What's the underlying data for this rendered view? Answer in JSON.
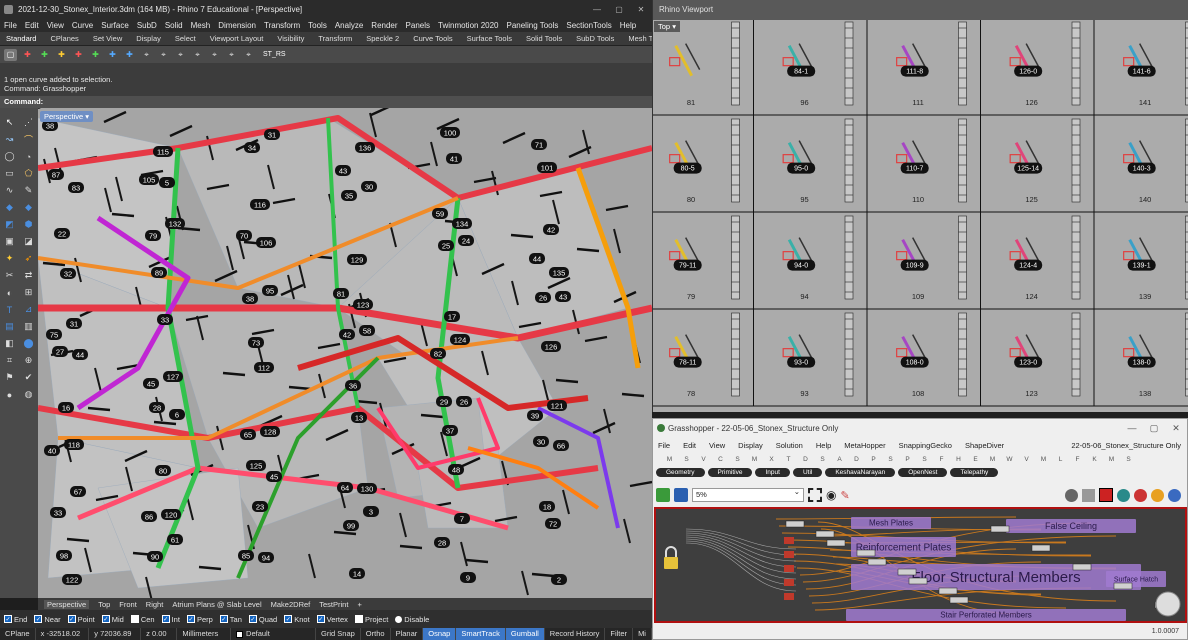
{
  "rhino": {
    "title": "2021-12-30_Stonex_Interior.3dm (164 MB) - Rhino 7 Educational - [Perspective]",
    "menu": [
      "File",
      "Edit",
      "View",
      "Curve",
      "Surface",
      "SubD",
      "Solid",
      "Mesh",
      "Dimension",
      "Transform",
      "Tools",
      "Analyze",
      "Render",
      "Panels",
      "Twinmotion 2020",
      "Paneling Tools",
      "SectionTools",
      "Help"
    ],
    "tabs": [
      "Standard",
      "CPlanes",
      "Set View",
      "Display",
      "Select",
      "Viewport Layout",
      "Visibility",
      "Transform",
      "Speckle 2",
      "Curve Tools",
      "Surface Tools",
      "Solid Tools",
      "SubD Tools",
      "Mesh Tools"
    ],
    "toolbar_label": "ST_RS",
    "command_history": [
      "1 open curve added to selection.",
      "Command: Grasshopper"
    ],
    "command_prompt": "Command:",
    "viewport_name": "Perspective",
    "viewport_tabs": [
      "Perspective",
      "Top",
      "Front",
      "Right",
      "Atrium Plans @ Slab Level",
      "Make2DRef",
      "TestPrint",
      "+"
    ],
    "osnap": [
      {
        "label": "End",
        "checked": true
      },
      {
        "label": "Near",
        "checked": true
      },
      {
        "label": "Point",
        "checked": true
      },
      {
        "label": "Mid",
        "checked": true
      },
      {
        "label": "Cen",
        "checked": false
      },
      {
        "label": "Int",
        "checked": true
      },
      {
        "label": "Perp",
        "checked": true
      },
      {
        "label": "Tan",
        "checked": true
      },
      {
        "label": "Quad",
        "checked": true
      },
      {
        "label": "Knot",
        "checked": true
      },
      {
        "label": "Vertex",
        "checked": true
      }
    ],
    "osnap_project": "Project",
    "osnap_disable": "Disable",
    "status": {
      "cplane": "CPlane",
      "x": "x -32518.02",
      "y": "y 72036.89",
      "z": "z 0.00",
      "units": "Millimeters",
      "layer": "Default",
      "grid_snap": "Grid Snap",
      "ortho": "Ortho",
      "planar": "Planar",
      "osnap": "Osnap",
      "smarttrack": "SmartTrack",
      "gumball": "Gumball",
      "record_history": "Record History",
      "filter": "Filter",
      "filter_extra": "Mi"
    },
    "member_labels": [
      "38",
      "105",
      "70",
      "81",
      "82",
      "39",
      "40",
      "86",
      "85",
      "43",
      "59",
      "44",
      "75",
      "45",
      "65",
      "64",
      "28",
      "71",
      "87",
      "79",
      "38",
      "42",
      "29",
      "30",
      "33",
      "90",
      "34",
      "35",
      "25",
      "26",
      "27",
      "28",
      "125",
      "99",
      "100",
      "101",
      "22",
      "89",
      "73",
      "36",
      "37",
      "18",
      "98",
      "115",
      "116",
      "129",
      "17",
      "126",
      "16",
      "80",
      "23",
      "14",
      "41",
      "42",
      "32",
      "33",
      "112",
      "13",
      "48",
      "72",
      "122",
      "5",
      "106",
      "123",
      "124",
      "121",
      "118",
      "120",
      "94",
      "136",
      "134",
      "135",
      "31",
      "127",
      "128",
      "130",
      "7",
      "2",
      "83",
      "132",
      "95",
      "58",
      "26",
      "66",
      "67",
      "61",
      "31",
      "30",
      "24",
      "43",
      "44",
      "6",
      "45",
      "3",
      "9"
    ]
  },
  "rhino_viewport": {
    "title": "Rhino Viewport",
    "view_name": "Top",
    "cell_numbers": [
      [
        "81",
        "96",
        "111",
        "126",
        "141"
      ],
      [
        "80",
        "95",
        "110",
        "125",
        "140"
      ],
      [
        "79",
        "94",
        "109",
        "124",
        "139"
      ],
      [
        "78",
        "93",
        "108",
        "123",
        "138"
      ]
    ],
    "cell_tags": [
      [
        "",
        "84-1",
        "111-8",
        "126-0",
        "141-6"
      ],
      [
        "80-5",
        "95-0",
        "110-7",
        "125-14",
        "140-3"
      ],
      [
        "79-11",
        "94-0",
        "109-9",
        "124-4",
        "139-1"
      ],
      [
        "78-11",
        "93-0",
        "108-0",
        "123-0",
        "138-0"
      ]
    ]
  },
  "grasshopper": {
    "title": "Grasshopper - 22-05-06_Stonex_Structure Only",
    "menu": [
      "File",
      "Edit",
      "View",
      "Display",
      "Solution",
      "Help",
      "MetaHopper",
      "SnappingGecko",
      "ShapeDiver"
    ],
    "document": "22-05-06_Stonex_Structure Only",
    "category_letters": [
      "M",
      "S",
      "V",
      "C",
      "S",
      "M",
      "X",
      "T",
      "D",
      "S",
      "A",
      "D",
      "P",
      "S",
      "P",
      "S",
      "F",
      "H",
      "E",
      "M",
      "W",
      "V",
      "M",
      "L",
      "F",
      "K",
      "M",
      "S"
    ],
    "subtabs": [
      "Geometry",
      "Primitive",
      "Input",
      "Util",
      "KeshavaNarayan",
      "OpenNest",
      "Telepathy"
    ],
    "zoom": "5%",
    "groups": [
      "Mesh Plates",
      "False Ceiling",
      "Reinforcement Plates",
      "Floor Structural Members",
      "Surface Hatch",
      "Stair Perforated Members"
    ],
    "version": "1.0.0007",
    "colors": {
      "group_fill": "#a07ad0",
      "wire": "#c8781e",
      "canvas_border": "#b01010"
    }
  }
}
